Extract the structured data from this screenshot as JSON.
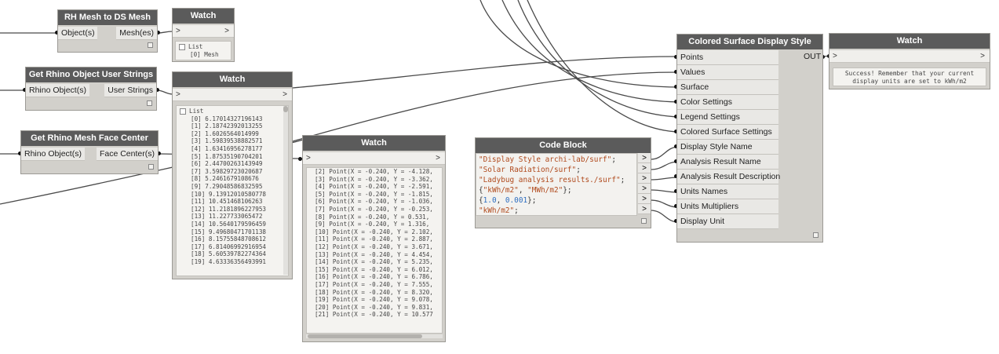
{
  "nodes": {
    "rh_mesh": {
      "title": "RH Mesh to DS Mesh",
      "input": "Object(s)",
      "output": "Mesh(es)"
    },
    "watch1": {
      "title": "Watch",
      "in_arrow": ">",
      "out_arrow": ">",
      "list_header": "List",
      "items": [
        "[0] Mesh"
      ]
    },
    "get_user_strings": {
      "title": "Get Rhino Object User Strings",
      "input": "Rhino Object(s)",
      "output": "User Strings"
    },
    "watch2": {
      "title": "Watch",
      "in_arrow": ">",
      "out_arrow": ">",
      "list_header": "List",
      "items": [
        "[0] 6.17014327196143",
        "[1] 2.18742392013255",
        "[2] 1.6026564014999",
        "[3] 1.59839538882571",
        "[4] 1.63416956278177",
        "[5] 1.87535190704201",
        "[6] 2.44700263143949",
        "[7] 3.59829723020687",
        "[8] 5.2461679108676",
        "[9] 7.29048586832595",
        "[10] 9.13912010580778",
        "[11] 10.451468106263",
        "[12] 11.2181896227953",
        "[13] 11.227733065472",
        "[14] 10.5640179596459",
        "[15] 9.49680471701138",
        "[16] 8.15755848708612",
        "[17] 6.81406992916954",
        "[18] 5.60539782274364",
        "[19] 4.63336356493991"
      ]
    },
    "get_face_center": {
      "title": "Get Rhino Mesh Face Center",
      "input": "Rhino Object(s)",
      "output": "Face Center(s)"
    },
    "watch3": {
      "title": "Watch",
      "in_arrow": ">",
      "out_arrow": ">",
      "items": [
        "[2] Point(X = -0.240, Y = -4.128,",
        "[3] Point(X = -0.240, Y = -3.362,",
        "[4] Point(X = -0.240, Y = -2.591,",
        "[5] Point(X = -0.240, Y = -1.815,",
        "[6] Point(X = -0.240, Y = -1.036,",
        "[7] Point(X = -0.240, Y = -0.253,",
        "[8] Point(X = -0.240, Y = 0.531,",
        "[9] Point(X = -0.240, Y = 1.316,",
        "[10] Point(X = -0.240, Y = 2.102,",
        "[11] Point(X = -0.240, Y = 2.887,",
        "[12] Point(X = -0.240, Y = 3.671,",
        "[13] Point(X = -0.240, Y = 4.454,",
        "[14] Point(X = -0.240, Y = 5.235,",
        "[15] Point(X = -0.240, Y = 6.012,",
        "[16] Point(X = -0.240, Y = 6.786,",
        "[17] Point(X = -0.240, Y = 7.555,",
        "[18] Point(X = -0.240, Y = 8.320,",
        "[19] Point(X = -0.240, Y = 9.078,",
        "[20] Point(X = -0.240, Y = 9.831,",
        "[21] Point(X = -0.240, Y = 10.577"
      ]
    },
    "code_block": {
      "title": "Code Block",
      "out_arrow": ">",
      "lines": [
        [
          {
            "t": "\"Display Style archi-lab/surf\"",
            "c": "str"
          },
          {
            "t": ";",
            "c": "pun"
          }
        ],
        [
          {
            "t": "\"Solar Radiation/surf\"",
            "c": "str"
          },
          {
            "t": ";",
            "c": "pun"
          }
        ],
        [
          {
            "t": "\"Ladybug analysis results./surf\"",
            "c": "str"
          },
          {
            "t": ";",
            "c": "pun"
          }
        ],
        [
          {
            "t": "{",
            "c": "pun"
          },
          {
            "t": "\"kWh/m2\"",
            "c": "str"
          },
          {
            "t": ", ",
            "c": "pun"
          },
          {
            "t": "\"MWh/m2\"",
            "c": "str"
          },
          {
            "t": "};",
            "c": "pun"
          }
        ],
        [
          {
            "t": "{",
            "c": "pun"
          },
          {
            "t": "1.0",
            "c": "num"
          },
          {
            "t": ", ",
            "c": "pun"
          },
          {
            "t": "0.001",
            "c": "num"
          },
          {
            "t": "};",
            "c": "pun"
          }
        ],
        [
          {
            "t": "\"kWh/m2\"",
            "c": "str"
          },
          {
            "t": ";",
            "c": "pun"
          }
        ]
      ]
    },
    "colored_surface": {
      "title": "Colored Surface Display Style",
      "output": "OUT",
      "inputs": [
        "Points",
        "Values",
        "Surface",
        "Color Settings",
        "Legend Settings",
        "Colored Surface Settings",
        "Display Style Name",
        "Analysis Result Name",
        "Analysis Result Description",
        "Units Names",
        "Units Multipliers",
        "Display Unit"
      ]
    },
    "watch4": {
      "title": "Watch",
      "in_arrow": ">",
      "out_arrow": ">",
      "message": "Success! Remember that your current\ndisplay units are set to kWh/m2"
    }
  }
}
